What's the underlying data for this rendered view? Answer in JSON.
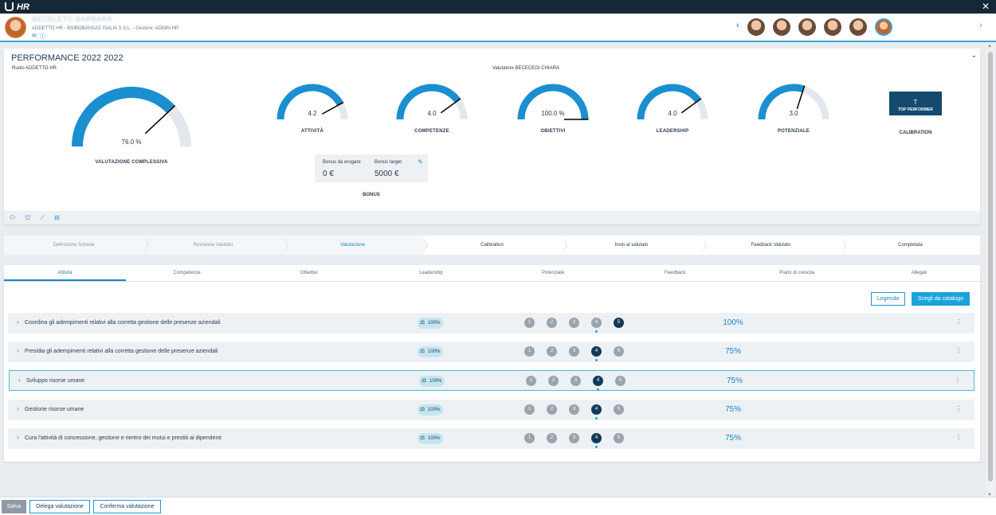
{
  "app": {
    "title": "HR",
    "close_icon": "close-icon"
  },
  "user": {
    "name": "BECELETO BARBARA",
    "role_line": "ADDETTO HR - BSIBOBANSAS ISALIA S.S.L. - Gestore: ADMIN HR"
  },
  "performance": {
    "title": "PERFORMANCE 2022 2022",
    "role": "Ruolo ADDETTO HR",
    "valutatore": "Valutatore BECECEGI CHIARA",
    "overall": {
      "label": "VALUTAZIONE COMPLESSIVA",
      "value_text": "76.0 %",
      "fraction": 0.76
    },
    "gauges": [
      {
        "label": "ATTIVITÀ",
        "value_text": "4.2",
        "fraction": 0.84
      },
      {
        "label": "COMPETENZE",
        "value_text": "4.0",
        "fraction": 0.8
      },
      {
        "label": "OBIETTIVI",
        "value_text": "100.0 %",
        "fraction": 1.0
      },
      {
        "label": "LEADERSHIP",
        "value_text": "4.0",
        "fraction": 0.8
      },
      {
        "label": "POTENZIALE",
        "value_text": "3.0",
        "fraction": 0.6
      }
    ],
    "calibration": {
      "letter": "T",
      "badge": "TOP PERFORMER",
      "label": "CALIBRATION"
    },
    "bonus": {
      "label": "BONUS",
      "da_erogare_label": "Bonus da erogare",
      "da_erogare_value": "0 €",
      "target_label": "Bonus target",
      "target_value": "5000 €"
    }
  },
  "steps": [
    {
      "label": "Definizione Scheda",
      "state": "done"
    },
    {
      "label": "Revisione Valutato",
      "state": "done"
    },
    {
      "label": "Valutazione",
      "state": "active"
    },
    {
      "label": "Calibration",
      "state": "future"
    },
    {
      "label": "Invio al valutato",
      "state": "future"
    },
    {
      "label": "Feedback Valutato",
      "state": "future"
    },
    {
      "label": "Completata",
      "state": "future"
    }
  ],
  "tabs": [
    "Attività",
    "Competenze",
    "Obiettivi",
    "Leadership",
    "Potenziale",
    "Feedback",
    "Piano di crescita",
    "Allegati"
  ],
  "actions": {
    "legenda": "Legenda",
    "catalogo": "Scegli da catalogo"
  },
  "activities": [
    {
      "title": "Coordina gli adempimenti relativi alla corretta gestione delle presenze aziendali",
      "weight": "100%",
      "selected": 5,
      "mark": 4,
      "pct": "100%"
    },
    {
      "title": "Presidia gli adempimenti relativi alla corretta gestione delle presenze aziendali",
      "weight": "100%",
      "selected": 4,
      "mark": 4,
      "pct": "75%"
    },
    {
      "title": "Sviluppo risorse umane",
      "weight": "100%",
      "selected": 4,
      "mark": 4,
      "pct": "75%"
    },
    {
      "title": "Gestione risorse umane",
      "weight": "100%",
      "selected": 4,
      "mark": 4,
      "pct": "75%"
    },
    {
      "title": "Cura l'attività di concessione, gestione e rientro dei mutui e prestiti ai dipendenti",
      "weight": "100%",
      "selected": 4,
      "mark": 4,
      "pct": "75%"
    }
  ],
  "bottom": {
    "salva": "Salva",
    "delega": "Delega valutazione",
    "conferma": "Conferma valutazione"
  },
  "colors": {
    "accent": "#1b84c4",
    "gauge_fill": "#1b8fd0",
    "gauge_track": "#e3e8ee",
    "dark": "#134a6e"
  }
}
